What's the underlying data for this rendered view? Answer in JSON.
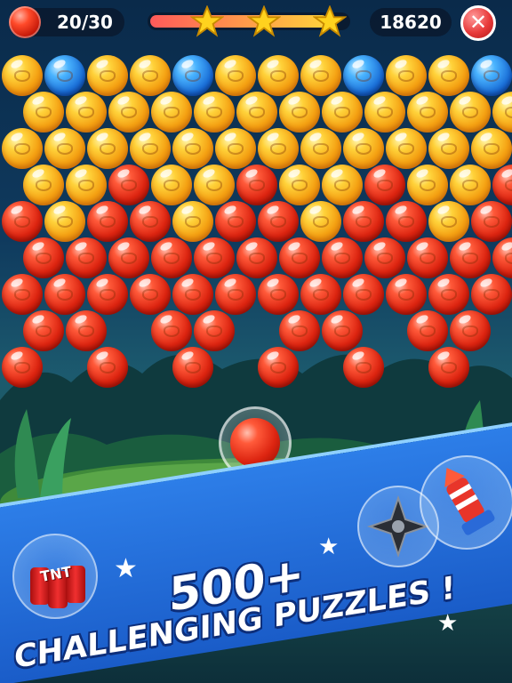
{
  "hud": {
    "shots_label": "20/30",
    "score_label": "18620",
    "close_label": "✕",
    "stars_filled": 3,
    "progress_fraction": 0.9
  },
  "bubbles": {
    "rows": [
      "YBYYBYYYBYYBY",
      "YYYYYYYYYYYY",
      "YYYYYYYYYYYYY",
      "YYRYYRYYRYYR",
      "RYRRYRRYRRYRR",
      "RRRRRRRRRRRR",
      "RRRRRRRRRRRRR",
      "RR_RR_RR_RR_",
      "R_R_R_R_R_R_"
    ],
    "row_offsets_alt": true
  },
  "shooter": {
    "color": "red"
  },
  "banner": {
    "line1": "500+",
    "line2": "CHALLENGING PUZZLES !",
    "tnt_label": "TNT"
  },
  "colors": {
    "yellow": "#f4a012",
    "red": "#dc2410",
    "blue": "#1a6fd8",
    "banner_blue": "#2d7ee8",
    "outline": "#0d2e7a"
  }
}
